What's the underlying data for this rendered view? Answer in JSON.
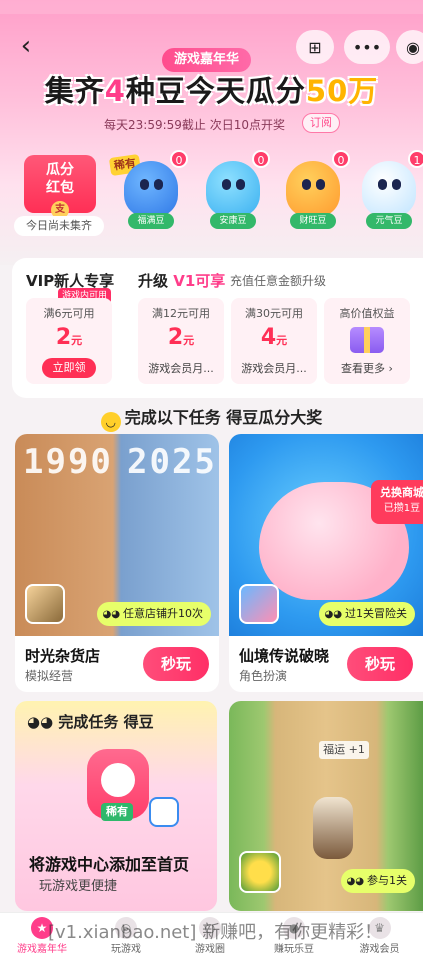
{
  "header": {
    "event_tag": "游戏嘉年华",
    "title_part1": "集齐",
    "title_num": "4",
    "title_part2": "种豆今天瓜分",
    "title_amount": "50万",
    "deadline": "每天23:59:59截止 次日10点开奖",
    "subscribe_label": "订阅"
  },
  "envelope": {
    "label_line1": "瓜分",
    "label_line2": "红包",
    "seal": "支",
    "status": "今日尚未集齐"
  },
  "beans": {
    "rare_tag": "稀有",
    "items": [
      {
        "name": "福满豆",
        "count": "0"
      },
      {
        "name": "安康豆",
        "count": "0"
      },
      {
        "name": "财旺豆",
        "count": "0"
      },
      {
        "name": "元气豆",
        "count": "1"
      }
    ]
  },
  "vip": {
    "new_title": "VIP新人专享",
    "new_tag": "游戏内可用",
    "upgrade_prefix": "升级",
    "upgrade_level": "V1可享",
    "upgrade_note": "充值任意金额升级",
    "coupons": [
      {
        "cond": "满6元可用",
        "amount": "2",
        "unit": "元",
        "action": "立即领"
      },
      {
        "cond": "满12元可用",
        "amount": "2",
        "unit": "元",
        "foot": "游戏会员月..."
      },
      {
        "cond": "满30元可用",
        "amount": "4",
        "unit": "元",
        "foot": "游戏会员月..."
      },
      {
        "cond": "高价值权益",
        "foot": "查看更多 ›"
      }
    ]
  },
  "tasks_header": "完成以下任务 得豆瓜分大奖",
  "games": [
    {
      "name": "时光杂货店",
      "genre": "模拟经营",
      "task": "任意店铺升10次",
      "play": "秒玩",
      "art_years": [
        "1990",
        "2025"
      ]
    },
    {
      "name": "仙境传说破晓",
      "genre": "角色扮演",
      "task": "过1关冒险关",
      "play": "秒玩",
      "redeem_title": "兑换商城",
      "redeem_sub": "已攒1豆"
    }
  ],
  "promo": {
    "head": "完成任务 得豆",
    "rare": "稀有",
    "title": "将游戏中心添加至首页",
    "subtitle": "玩游戏更便捷"
  },
  "road": {
    "sign": "福运 +1",
    "task": "参与1关"
  },
  "tabs": [
    {
      "label": "游戏嘉年华",
      "active": true
    },
    {
      "label": "玩游戏",
      "active": false
    },
    {
      "label": "游戏圈",
      "active": false
    },
    {
      "label": "赚玩乐豆",
      "active": false
    },
    {
      "label": "游戏会员",
      "active": false
    }
  ],
  "watermark": "[v1.xianbao.net] 新赚吧，有你更精彩！"
}
